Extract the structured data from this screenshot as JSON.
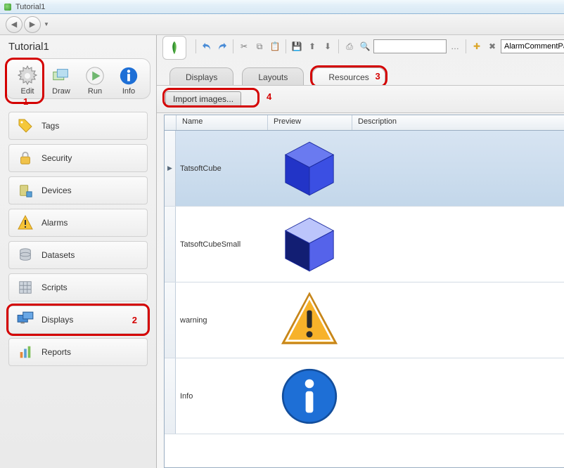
{
  "window": {
    "title": "Tutorial1"
  },
  "project": {
    "title": "Tutorial1"
  },
  "modes": {
    "edit": "Edit",
    "draw": "Draw",
    "run": "Run",
    "info": "Info"
  },
  "annotations": {
    "a1": "1",
    "a2": "2",
    "a3": "3",
    "a4": "4"
  },
  "sidebar": {
    "items": [
      {
        "label": "Tags"
      },
      {
        "label": "Security"
      },
      {
        "label": "Devices"
      },
      {
        "label": "Alarms"
      },
      {
        "label": "Datasets"
      },
      {
        "label": "Scripts"
      },
      {
        "label": "Displays"
      },
      {
        "label": "Reports"
      }
    ]
  },
  "toolbar": {
    "combo_value": "AlarmCommentPage"
  },
  "tabs": {
    "displays": "Displays",
    "layouts": "Layouts",
    "resources": "Resources"
  },
  "subtoolbar": {
    "import_label": "Import images..."
  },
  "grid": {
    "headers": {
      "name": "Name",
      "preview": "Preview",
      "description": "Description"
    },
    "rows": [
      {
        "name": "TatsoftCube",
        "description": ""
      },
      {
        "name": "TatsoftCubeSmall",
        "description": ""
      },
      {
        "name": "warning",
        "description": ""
      },
      {
        "name": "Info",
        "description": ""
      }
    ]
  }
}
